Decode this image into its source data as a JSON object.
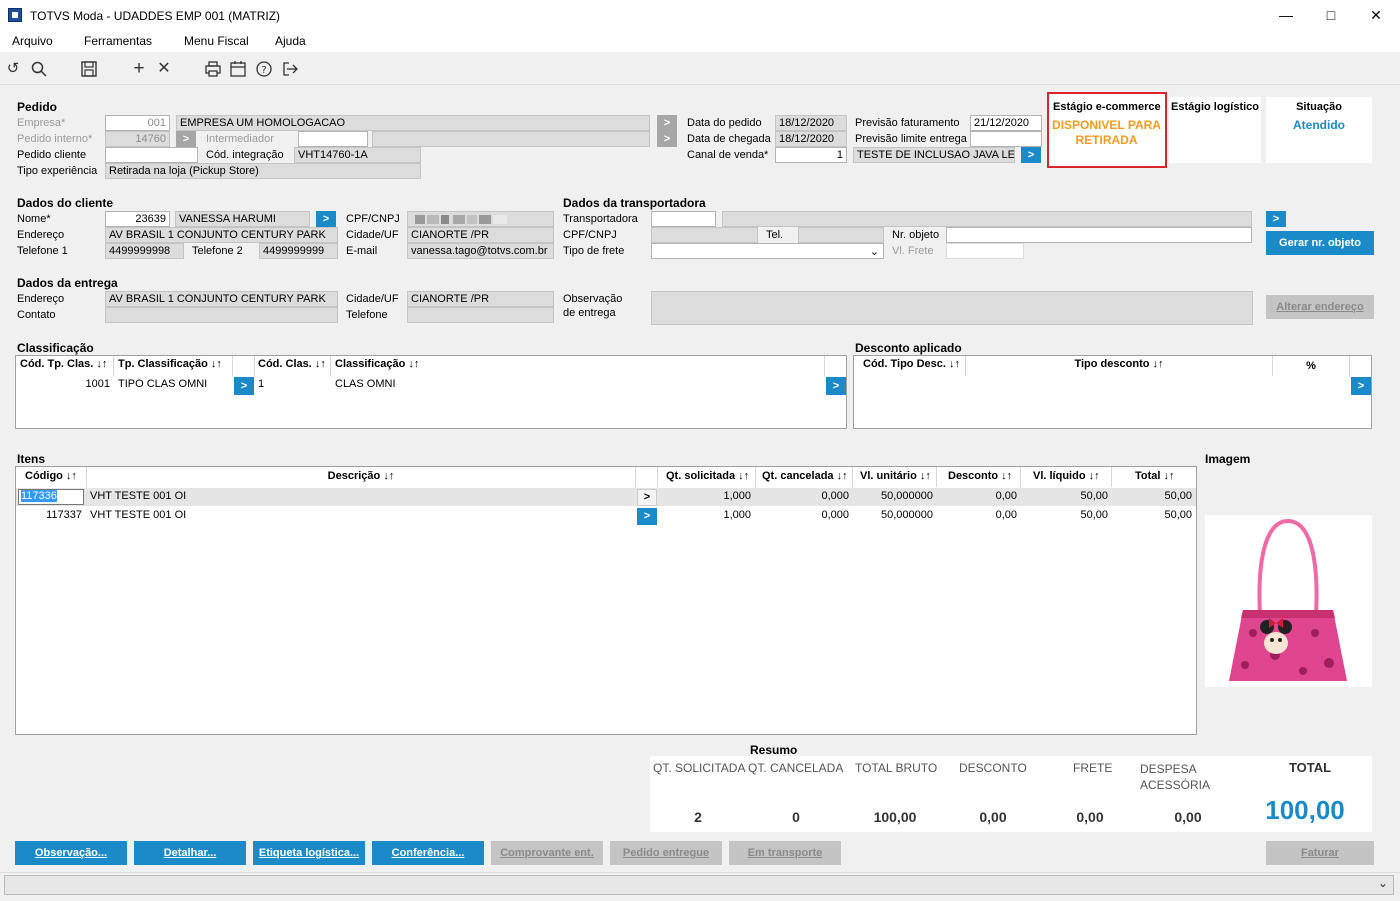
{
  "window": {
    "title": "TOTVS Moda - UDADDES EMP 001 (MATRIZ)"
  },
  "menu": [
    "Arquivo",
    "Ferramentas",
    "Menu Fiscal",
    "Ajuda"
  ],
  "toolbar_icons": [
    "undo-icon",
    "search-icon",
    "save-icon",
    "add-icon",
    "delete-icon",
    "print-icon",
    "calendar-icon",
    "help-icon",
    "exit-icon"
  ],
  "pedido": {
    "title": "Pedido",
    "empresa_label": "Empresa*",
    "empresa_code": "001",
    "empresa_name": "EMPRESA UM HOMOLOGACAO",
    "interno_label": "Pedido interno*",
    "interno_value": "14760",
    "intermediador_label": "Intermediador",
    "cliente_label": "Pedido cliente",
    "cliente_value": "",
    "cod_integracao_label": "Cód. integração",
    "cod_integracao_value": "VHT14760-1A",
    "tipo_exp_label": "Tipo experiência",
    "tipo_exp_value": "Retirada na loja (Pickup Store)",
    "data_pedido_label": "Data do pedido",
    "data_pedido_value": "18/12/2020",
    "data_chegada_label": "Data de chegada",
    "data_chegada_value": "18/12/2020",
    "canal_label": "Canal de venda*",
    "canal_code": "1",
    "canal_name": "TESTE DE INCLUSAO JAVA LEGA",
    "prev_fat_label": "Previsão faturamento",
    "prev_fat_value": "21/12/2020",
    "prev_lim_label": "Previsão limite entrega",
    "prev_lim_value": ""
  },
  "stages": {
    "ecommerce_title": "Estágio e-commerce",
    "ecommerce_value": "DISPONIVEL PARA RETIRADA",
    "logistico_title": "Estágio logístico",
    "situacao_title": "Situação",
    "situacao_value": "Atendido"
  },
  "cliente": {
    "title": "Dados do cliente",
    "nome_label": "Nome*",
    "nome_code": "23639",
    "nome_value": "VANESSA HARUMI",
    "endereco_label": "Endereço",
    "endereco_value": "AV BRASIL 1  CONJUNTO CENTURY PARK",
    "tel1_label": "Telefone 1",
    "tel1_value": "4499999998",
    "tel2_label": "Telefone 2",
    "tel2_value": "4499999999",
    "cpf_label": "CPF/CNPJ",
    "cidade_label": "Cidade/UF",
    "cidade_value": "CIANORTE /PR",
    "email_label": "E-mail",
    "email_value": "vanessa.tago@totvs.com.br"
  },
  "transportadora": {
    "title": "Dados da transportadora",
    "transp_label": "Transportadora",
    "cpf_label": "CPF/CNPJ",
    "tel_label": "Tel.",
    "nr_objeto_label": "Nr. objeto",
    "frete_label": "Tipo de frete",
    "vl_frete_label": "Vl. Frete",
    "gerar_button": "Gerar nr. objeto"
  },
  "entrega": {
    "title": "Dados da entrega",
    "endereco_label": "Endereço",
    "endereco_value": "AV BRASIL 1  CONJUNTO CENTURY PARK",
    "contato_label": "Contato",
    "cidade_label": "Cidade/UF",
    "cidade_value": "CIANORTE /PR",
    "telefone_label": "Telefone",
    "obs_label1": "Observação",
    "obs_label2": "de entrega",
    "alterar_button": "Alterar endereço"
  },
  "classificacao": {
    "title": "Classificação",
    "headers": [
      "Cód. Tp. Clas. ↓↑",
      "Tp. Classificação ↓↑",
      "Cód. Clas. ↓↑",
      "Classificação ↓↑"
    ],
    "rows": [
      {
        "cod_tp": "1001",
        "tp": "TIPO CLAS OMNI",
        "cod": "1",
        "clas": "CLAS OMNI"
      }
    ]
  },
  "desconto": {
    "title": "Desconto aplicado",
    "headers": [
      "Cód. Tipo Desc. ↓↑",
      "Tipo desconto ↓↑",
      "%"
    ]
  },
  "itens": {
    "title": "Itens",
    "headers": [
      "Código ↓↑",
      "Descrição ↓↑",
      "Qt. solicitada ↓↑",
      "Qt. cancelada ↓↑",
      "Vl. unitário ↓↑",
      "Desconto ↓↑",
      "Vl. líquido ↓↑",
      "Total ↓↑"
    ],
    "rows": [
      {
        "codigo": "117336",
        "descricao": "VHT TESTE 001 OI",
        "qt_sol": "1,000",
        "qt_can": "0,000",
        "vl_unit": "50,000000",
        "desconto": "0,00",
        "vl_liq": "50,00",
        "total": "50,00"
      },
      {
        "codigo": "117337",
        "descricao": "VHT TESTE 001 OI",
        "qt_sol": "1,000",
        "qt_can": "0,000",
        "vl_unit": "50,000000",
        "desconto": "0,00",
        "vl_liq": "50,00",
        "total": "50,00"
      }
    ]
  },
  "imagem": {
    "title": "Imagem"
  },
  "resumo": {
    "title": "Resumo",
    "labels": [
      "QT. SOLICITADA",
      "QT. CANCELADA",
      "TOTAL BRUTO",
      "DESCONTO",
      "FRETE",
      "DESPESA ACESSÓRIA"
    ],
    "values": [
      "2",
      "0",
      "100,00",
      "0,00",
      "0,00",
      "0,00"
    ],
    "total_label": "TOTAL",
    "total_value": "100,00"
  },
  "buttons": {
    "observacao": "Observação...",
    "detalhar": "Detalhar...",
    "etiqueta": "Etiqueta logística...",
    "conferencia": "Conferência...",
    "comprovante": "Comprovante ent.",
    "pedido_entregue": "Pedido entregue",
    "em_transporte": "Em transporte",
    "faturar": "Faturar"
  },
  "colors": {
    "accent": "#1b8ac8",
    "stage_orange": "#f49b1e",
    "stage_border": "#d9262b",
    "bag_pink": "#e0458f"
  }
}
